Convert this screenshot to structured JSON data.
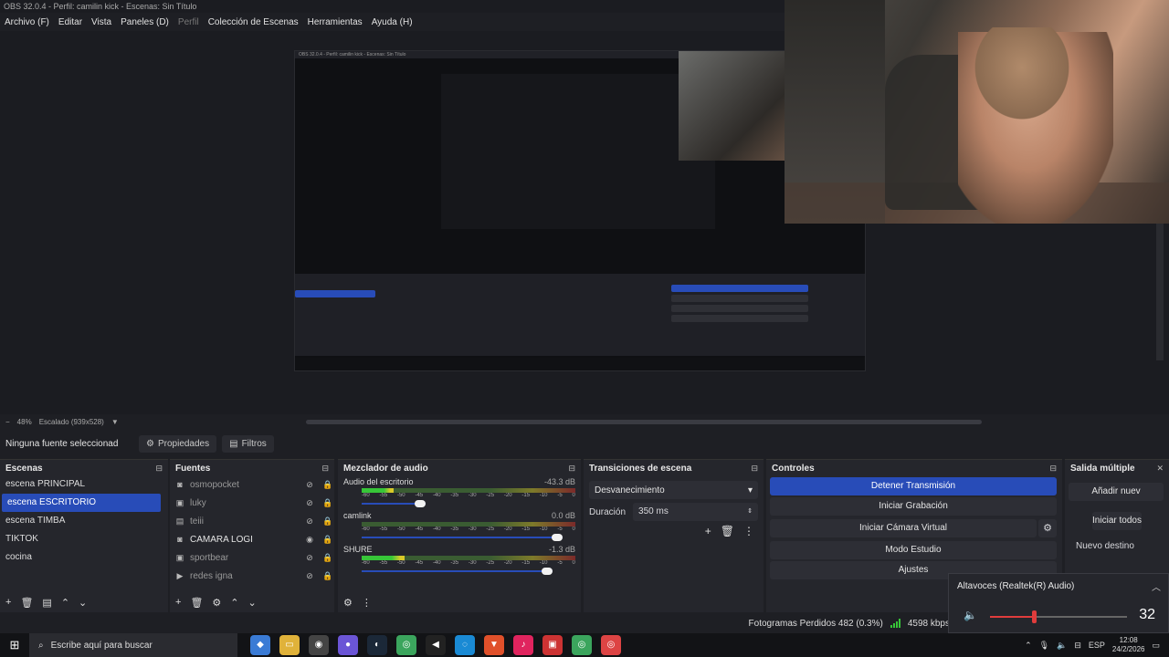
{
  "window": {
    "title": "OBS 32.0.4 - Perfil: camilin kick - Escenas: Sin Título"
  },
  "menu": [
    {
      "label": "Archivo (F)",
      "disabled": false
    },
    {
      "label": "Editar",
      "disabled": false
    },
    {
      "label": "Vista",
      "disabled": false
    },
    {
      "label": "Paneles (D)",
      "disabled": false
    },
    {
      "label": "Perfil",
      "disabled": true
    },
    {
      "label": "Colección de Escenas",
      "disabled": false
    },
    {
      "label": "Herramientas",
      "disabled": false
    },
    {
      "label": "Ayuda (H)",
      "disabled": false
    }
  ],
  "preview": {
    "zoom": "48%",
    "scaling": "Escalado (939x528)"
  },
  "props_bar": {
    "no_source": "Ninguna fuente seleccionad",
    "properties": "Propiedades",
    "filters": "Filtros"
  },
  "scenes": {
    "title": "Escenas",
    "items": [
      "escena PRINCIPAL",
      "escena ESCRITORIO",
      "escena TIMBA",
      "TIKTOK",
      "cocina"
    ],
    "selected_index": 1
  },
  "sources": {
    "title": "Fuentes",
    "items": [
      {
        "name": "osmopocket",
        "icon": "camera-icon",
        "visible": false
      },
      {
        "name": "luky",
        "icon": "image-icon",
        "visible": false
      },
      {
        "name": "teiii",
        "icon": "text-icon",
        "visible": false
      },
      {
        "name": "CAMARA LOGI",
        "icon": "camera-icon",
        "visible": true
      },
      {
        "name": "sportbear",
        "icon": "image-icon",
        "visible": false
      },
      {
        "name": "redes igna",
        "icon": "media-icon",
        "visible": false
      }
    ]
  },
  "mixer": {
    "title": "Mezclador de audio",
    "channels": [
      {
        "name": "Audio del escritorio",
        "db": "-43.3 dB",
        "level": 0.15,
        "volume": 0.32,
        "muted": false
      },
      {
        "name": "camlink",
        "db": "0.0 dB",
        "level": 0.0,
        "volume": 1.0,
        "muted": true
      },
      {
        "name": "SHURE",
        "db": "-1.3 dB",
        "level": 0.2,
        "volume": 0.95,
        "muted": false
      }
    ],
    "scale": [
      "-60",
      "-55",
      "-50",
      "-45",
      "-40",
      "-35",
      "-30",
      "-25",
      "-20",
      "-15",
      "-10",
      "-5",
      "0"
    ]
  },
  "transitions": {
    "title": "Transiciones de escena",
    "selected": "Desvanecimiento",
    "duration_label": "Duración",
    "duration_value": "350 ms"
  },
  "controls": {
    "title": "Controles",
    "stop_stream": "Detener Transmisión",
    "start_recording": "Iniciar Grabación",
    "start_virtualcam": "Iniciar Cámara Virtual",
    "studio_mode": "Modo Estudio",
    "settings": "Ajustes"
  },
  "multi_output": {
    "title": "Salida múltiple",
    "add": "Añadir nuev",
    "start_all": "Iniciar todos",
    "new_target": "Nuevo destino"
  },
  "status": {
    "dropped": "Fotogramas Perdidos 482 (0.3%)",
    "bitrate": "4598 kbps"
  },
  "volume_popup": {
    "device": "Altavoces (Realtek(R) Audio)",
    "value": "32",
    "level": 0.32
  },
  "taskbar": {
    "search_placeholder": "Escribe aquí para buscar",
    "lang": "ESP",
    "time": "12:08",
    "date": "24/2/2026"
  }
}
